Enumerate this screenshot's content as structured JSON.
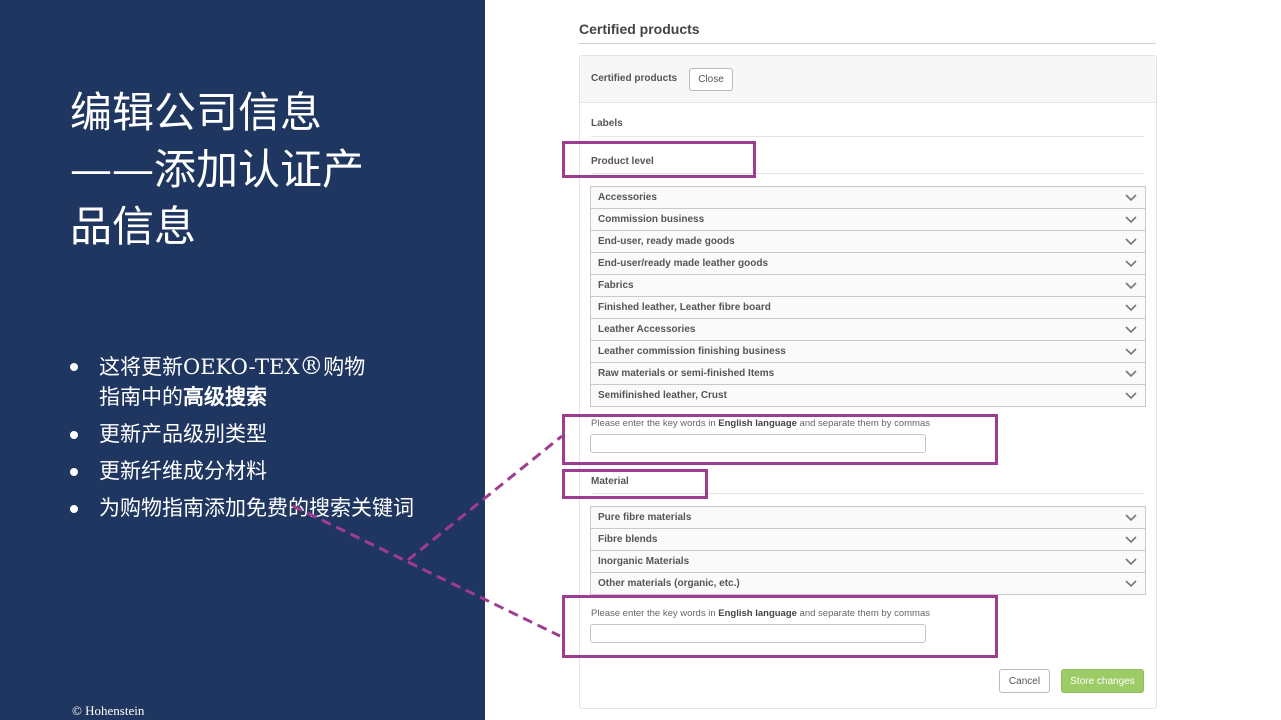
{
  "left": {
    "title_lines": [
      "编辑公司信息",
      "——添加认证产",
      "品信息"
    ],
    "bullets": {
      "b1_pre": "这将更新OEKO-TEX",
      "b1_reg": "®",
      "b1_mid": "购物",
      "b1_line2_pre": "指南中的",
      "b1_strong": "高级搜索",
      "b2": "更新产品级别类型",
      "b3": "更新纤维成分材料",
      "b4": "为购物指南添加免费的搜索关键词"
    },
    "copyright": "© Hohenstein"
  },
  "right": {
    "section_title": "Certified products",
    "panel_header": {
      "title": "Certified products",
      "close_label": "Close"
    },
    "labels_heading": "Labels",
    "product_level_heading": "Product level",
    "product_levels": [
      "Accessories",
      "Commission business",
      "End-user, ready made goods",
      "End-user/ready made leather goods",
      "Fabrics",
      "Finished leather, Leather fibre board",
      "Leather Accessories",
      "Leather commission finishing business",
      "Raw materials or semi-finished Items",
      "Semifinished leather, Crust"
    ],
    "keyword_hint": {
      "pre": "Please enter the key words in ",
      "strong": "English language",
      "post": " and separate them by commas"
    },
    "material_heading": "Material",
    "materials": [
      "Pure fibre materials",
      "Fibre blends",
      "Inorganic Materials",
      "Other materials (organic, etc.)"
    ],
    "cancel_label": "Cancel",
    "store_label": "Store changes"
  },
  "colors": {
    "left_panel_bg": "#1f3660",
    "highlight": "#9e3c92",
    "store_button": "#9ccc65"
  },
  "icons": {
    "accordion": "chevron-down-icon"
  }
}
